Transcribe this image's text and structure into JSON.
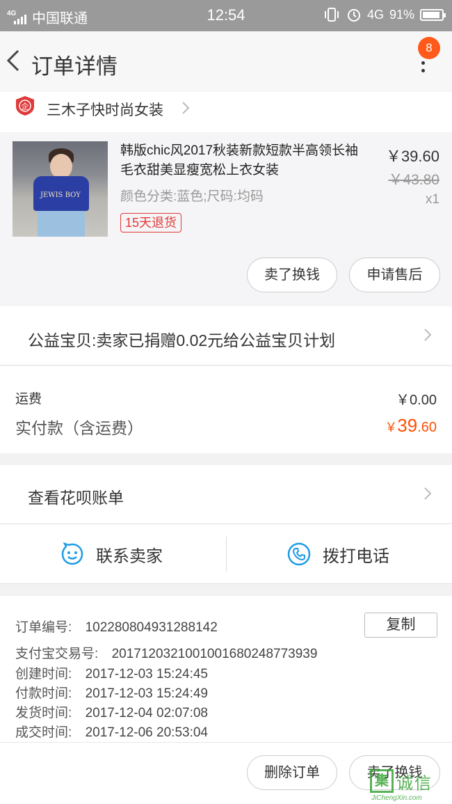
{
  "status_bar": {
    "network": "4G",
    "carrier": "中国联通",
    "time": "12:54",
    "network_right": "4G",
    "battery": "91%"
  },
  "nav": {
    "title": "订单详情",
    "badge_count": "8"
  },
  "shop": {
    "name": "三木子快时尚女装",
    "shop_badge_char": "企"
  },
  "item": {
    "title": "韩版chic风2017秋装新款短款半高领长袖毛衣甜美显瘦宽松上衣女装",
    "spec": "颜色分类:蓝色;尺码:均码",
    "tag": "15天退货",
    "price": "￥39.60",
    "original_price": "￥43.80",
    "quantity": "x1",
    "thumb_text": "JEWIS BOY",
    "sell_button": "卖了换钱",
    "aftersale_button": "申请售后"
  },
  "charity": {
    "text": "公益宝贝:卖家已捐赠0.02元给公益宝贝计划"
  },
  "fees": {
    "shipping_label": "运费",
    "shipping_value": "￥0.00",
    "paid_label": "实付款（含运费）",
    "paid_currency": "￥",
    "paid_int": "39",
    "paid_dec": ".60"
  },
  "huabei": {
    "text": "查看花呗账单"
  },
  "contact": {
    "seller_label": "联系卖家",
    "call_label": "拨打电话"
  },
  "order_info": {
    "order_no_label": "订单编号:",
    "order_no": "102280804931288142",
    "copy_button": "复制",
    "alipay_label": "支付宝交易号:",
    "alipay_no": "2017120321001001680248773939",
    "created_label": "创建时间:",
    "created": "2017-12-03 15:24:45",
    "paid_label": "付款时间:",
    "paid": "2017-12-03 15:24:49",
    "shipped_label": "发货时间:",
    "shipped": "2017-12-04 02:07:08",
    "done_label": "成交时间:",
    "done": "2017-12-06 20:53:04"
  },
  "bottom": {
    "delete_button": "删除订单",
    "sell_button": "卖了换钱"
  },
  "watermark": {
    "box_char": "集",
    "cn": "诚信",
    "en": "JiChengXin.com"
  },
  "colors": {
    "accent": "#ff5000",
    "badge": "#ff5a1a",
    "tag_red": "#e23a3a",
    "contact_blue": "#1e9be6"
  },
  "icons": [
    "back-arrow-icon",
    "more-vertical-icon",
    "shop-badge-icon",
    "chevron-right-icon",
    "wangwang-chat-icon",
    "phone-icon",
    "vibrate-icon",
    "alarm-icon",
    "battery-icon",
    "signal-icon"
  ]
}
